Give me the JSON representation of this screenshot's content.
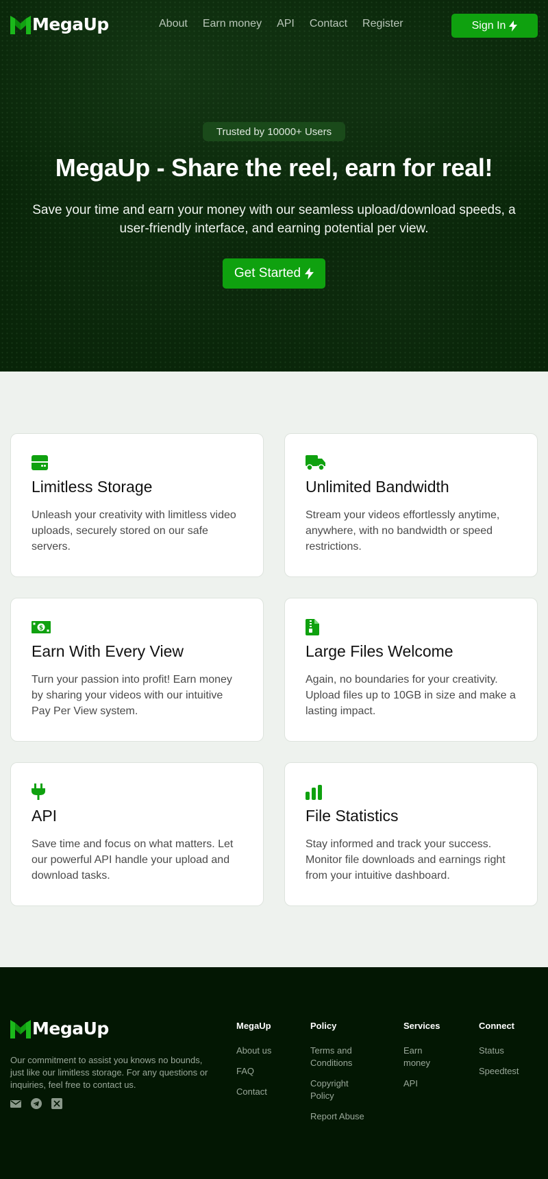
{
  "brand": {
    "name": "MegaUp",
    "accent": "#0fa10f"
  },
  "nav": {
    "links": [
      "About",
      "Earn money",
      "API",
      "Contact",
      "Register"
    ],
    "signin_label": "Sign In"
  },
  "hero": {
    "badge": "Trusted by 10000+ Users",
    "title": "MegaUp - Share the reel, earn for real!",
    "subtitle": "Save your time and earn your money with our seamless upload/download speeds, a user-friendly interface, and earning potential per view.",
    "cta_label": "Get Started"
  },
  "features": [
    {
      "icon": "storage-icon",
      "title": "Limitless Storage",
      "text": "Unleash your creativity with limitless video uploads, securely stored on our safe servers."
    },
    {
      "icon": "truck-icon",
      "title": "Unlimited Bandwidth",
      "text": "Stream your videos effortlessly anytime, anywhere, with no bandwidth or speed restrictions."
    },
    {
      "icon": "cash-icon",
      "title": "Earn With Every View",
      "text": "Turn your passion into profit! Earn money by sharing your videos with our intuitive Pay Per View system."
    },
    {
      "icon": "zip-file-icon",
      "title": "Large Files Welcome",
      "text": "Again, no boundaries for your creativity. Upload files up to 10GB in size and make a lasting impact."
    },
    {
      "icon": "plug-icon",
      "title": "API",
      "text": "Save time and focus on what matters. Let our powerful API handle your upload and download tasks."
    },
    {
      "icon": "bar-chart-icon",
      "title": "File Statistics",
      "text": "Stay informed and track your success. Monitor file downloads and earnings right from your intuitive dashboard."
    }
  ],
  "footer": {
    "brand": "MegaUp",
    "about": "Our commitment to assist you knows no bounds, just like our limitless storage. For any questions or inquiries, feel free to contact us.",
    "social": [
      "email-icon",
      "telegram-icon",
      "x-icon"
    ],
    "columns": [
      {
        "title": "MegaUp",
        "links": [
          "About us",
          "FAQ",
          "Contact"
        ]
      },
      {
        "title": "Policy",
        "links": [
          "Terms and Conditions",
          "Copyright Policy",
          "Report Abuse"
        ]
      },
      {
        "title": "Services",
        "links": [
          "Earn money",
          "API"
        ]
      },
      {
        "title": "Connect",
        "links": [
          "Status",
          "Speedtest"
        ]
      }
    ]
  }
}
